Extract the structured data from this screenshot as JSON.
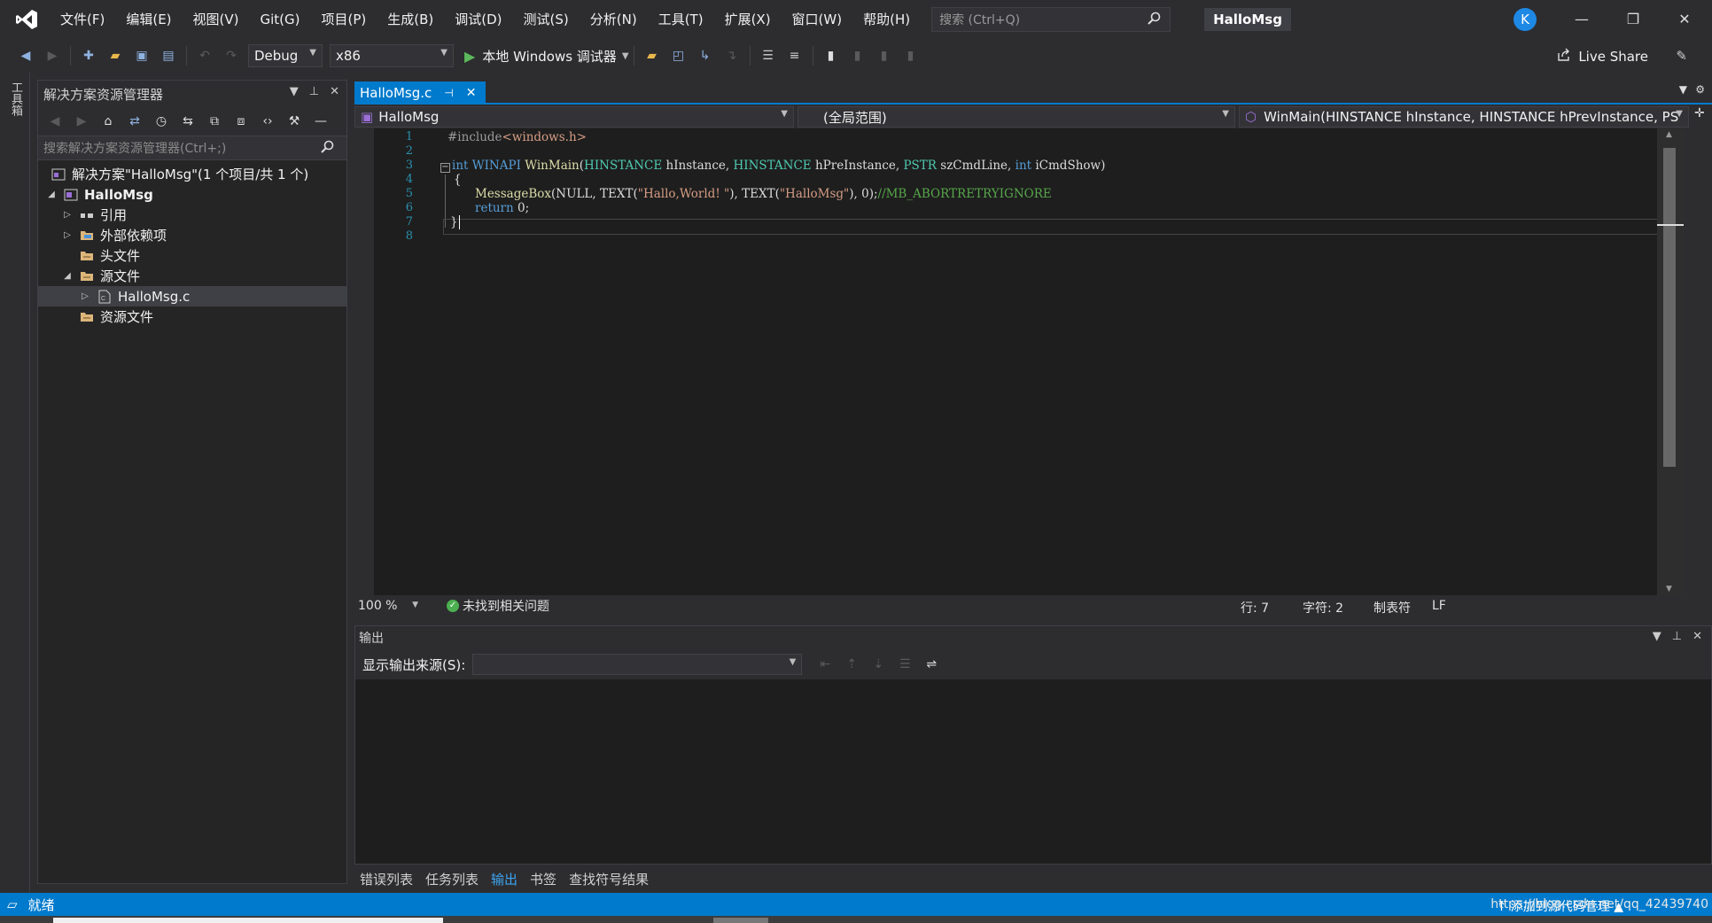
{
  "menu": [
    "文件(F)",
    "编辑(E)",
    "视图(V)",
    "Git(G)",
    "项目(P)",
    "生成(B)",
    "调试(D)",
    "测试(S)",
    "分析(N)",
    "工具(T)",
    "扩展(X)",
    "窗口(W)",
    "帮助(H)"
  ],
  "search": {
    "placeholder": "搜索 (Ctrl+Q)"
  },
  "app_title": "HalloMsg",
  "avatar_letter": "K",
  "toolbar": {
    "config": "Debug",
    "platform": "x86",
    "run_label": "本地 Windows 调试器",
    "live_share": "Live Share"
  },
  "toolstrip": {
    "tab": "工具箱"
  },
  "solution_explorer": {
    "title": "解决方案资源管理器",
    "search_placeholder": "搜索解决方案资源管理器(Ctrl+;)",
    "items": [
      {
        "label": "解决方案\"HalloMsg\"(1 个项目/共 1 个)",
        "icon": "solution-icon"
      },
      {
        "label": "HalloMsg",
        "icon": "project-icon"
      },
      {
        "label": "引用",
        "icon": "references-icon"
      },
      {
        "label": "外部依赖项",
        "icon": "folder-icon"
      },
      {
        "label": "头文件",
        "icon": "folder-icon"
      },
      {
        "label": "源文件",
        "icon": "folder-icon"
      },
      {
        "label": "HalloMsg.c",
        "icon": "c-file-icon"
      },
      {
        "label": "资源文件",
        "icon": "folder-icon"
      }
    ]
  },
  "editor": {
    "tab_label": "HalloMsg.c",
    "nav": {
      "project": "HalloMsg",
      "scope": "(全局范围)",
      "member": "WinMain(HINSTANCE hInstance, HINSTANCE hPrevInstance, PS"
    },
    "line_numbers": [
      "1",
      "2",
      "3",
      "4",
      "5",
      "6",
      "7",
      "8"
    ],
    "code": {
      "l1_directive": "#include",
      "l1_header": "<windows.h>",
      "l3_int": "int",
      "l3_winapi": " WINAPI ",
      "l3_func": "WinMain",
      "l3_p1": "(",
      "l3_t1": "HINSTANCE",
      "l3_p2": " hInstance, ",
      "l3_t2": "HINSTANCE",
      "l3_p3": " hPreInstance, ",
      "l3_t3": "PSTR",
      "l3_p4": " szCmdLine, ",
      "l3_t4": "int",
      "l3_p5": " iCmdShow)",
      "l4": "{",
      "l5_func": "MessageBox",
      "l5_a": "(NULL, TEXT(",
      "l5_s1": "\"Hallo,World! \"",
      "l5_b": "), TEXT(",
      "l5_s2": "\"HalloMsg\"",
      "l5_c": "), 0);",
      "l5_comment": "//MB_ABORTRETRYIGNORE",
      "l6_kw": "return",
      "l6_rest": " 0;",
      "l7": "}"
    }
  },
  "editor_status": {
    "zoom": "100 %",
    "issues": "未找到相关问题",
    "line": "行: 7",
    "char": "字符: 2",
    "indent": "制表符",
    "eol": "LF"
  },
  "output": {
    "title": "输出",
    "source_label": "显示输出来源(S):"
  },
  "bottom_tabs": [
    "错误列表",
    "任务列表",
    "输出",
    "书签",
    "查找符号结果"
  ],
  "status_bar": {
    "ready": "就绪",
    "source_control": "添加到源代码管理",
    "watermark": "https://blog.csdn.net/qq_42439740"
  }
}
